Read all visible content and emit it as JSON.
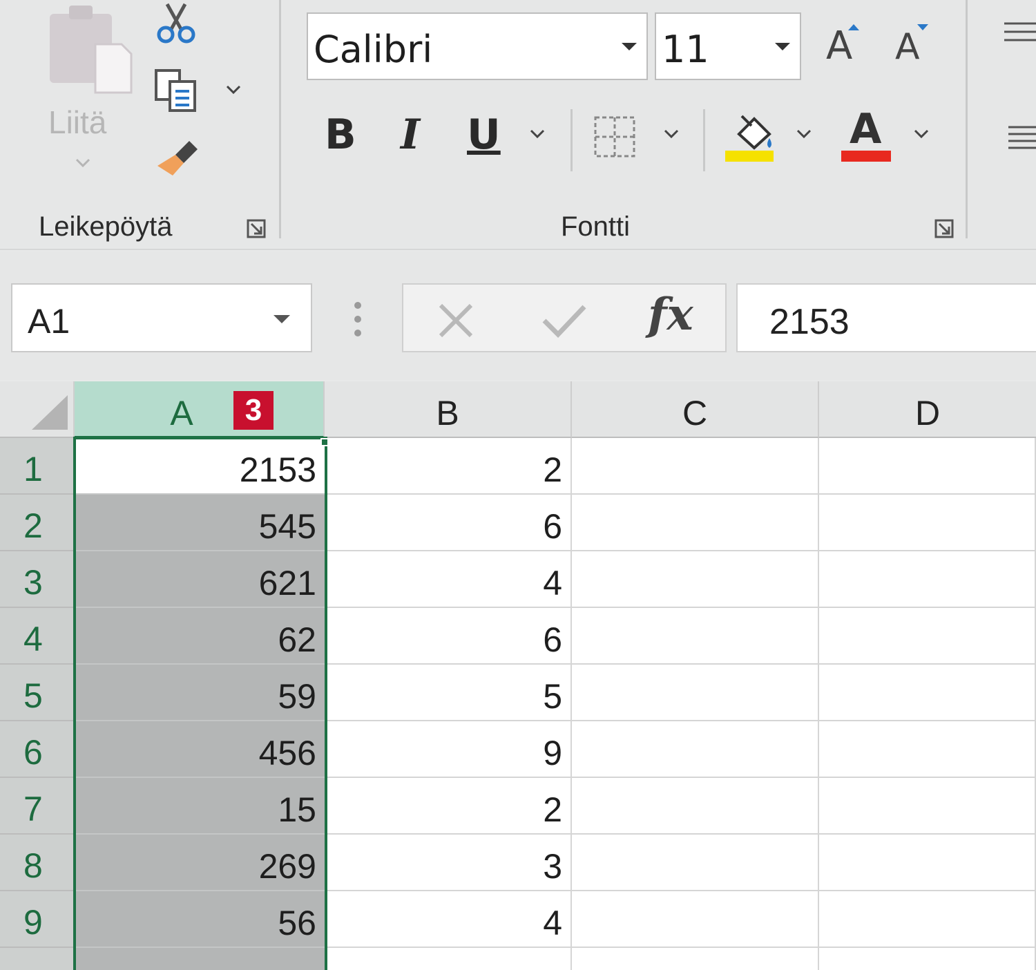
{
  "ribbon": {
    "clipboard": {
      "paste_label": "Liitä",
      "group_label": "Leikepöytä"
    },
    "font": {
      "font_name": "Calibri",
      "font_size": "11",
      "bold": "B",
      "italic": "I",
      "underline": "U",
      "font_color_glyph": "A",
      "grow_glyph": "A",
      "shrink_glyph": "A",
      "group_label": "Fontti",
      "fill_color": "#f5e100",
      "font_color": "#e8291f"
    }
  },
  "formula_bar": {
    "name_box": "A1",
    "fx": "fx",
    "value": "2153"
  },
  "sheet": {
    "columns": [
      "A",
      "B",
      "C",
      "D"
    ],
    "badge": "3",
    "rows": [
      {
        "row": "1",
        "a": "2153",
        "b": "2"
      },
      {
        "row": "2",
        "a": "545",
        "b": "6"
      },
      {
        "row": "3",
        "a": "621",
        "b": "4"
      },
      {
        "row": "4",
        "a": "62",
        "b": "6"
      },
      {
        "row": "5",
        "a": "59",
        "b": "5"
      },
      {
        "row": "6",
        "a": "456",
        "b": "9"
      },
      {
        "row": "7",
        "a": "15",
        "b": "2"
      },
      {
        "row": "8",
        "a": "269",
        "b": "3"
      },
      {
        "row": "9",
        "a": "56",
        "b": "4"
      }
    ],
    "selection_color": "#1e7145"
  }
}
